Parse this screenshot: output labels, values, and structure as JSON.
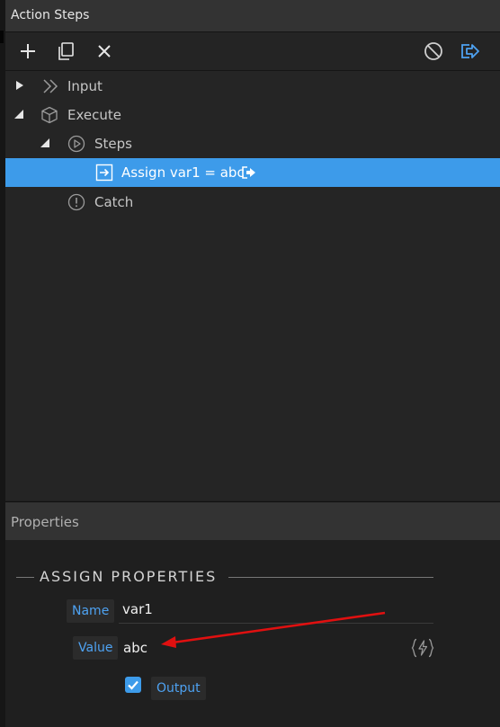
{
  "header": {
    "title": "Action Steps"
  },
  "toolbar": {
    "buttons": [
      {
        "icon": "plus-icon"
      },
      {
        "icon": "copy-icon"
      },
      {
        "icon": "close-icon"
      },
      {
        "icon": "disable-icon"
      },
      {
        "icon": "exit-icon"
      }
    ]
  },
  "tree": {
    "items": [
      {
        "label": "Input",
        "icon": "chevrons-right-icon",
        "expanded": false
      },
      {
        "label": "Execute",
        "icon": "cube-icon",
        "expanded": true
      },
      {
        "label": "Steps",
        "icon": "play-circle-icon",
        "expanded": true
      },
      {
        "label": "Assign var1 = abc",
        "icon": "assign-arrow-icon",
        "selected": true,
        "badge_icon": "exit-step-icon"
      },
      {
        "label": "Catch",
        "icon": "exclamation-circle-icon"
      }
    ]
  },
  "properties": {
    "panel_title": "Properties",
    "section_title": "ASSIGN PROPERTIES",
    "name": {
      "label": "Name",
      "value": "var1"
    },
    "value": {
      "label": "Value",
      "value": "abc",
      "dynamic_icon": "lightning-icon"
    },
    "output": {
      "label": "Output",
      "checked": true
    }
  },
  "annotation": {
    "type": "red-arrow",
    "color": "#e01010"
  },
  "colors": {
    "accent": "#3d9bea",
    "label_text": "#4ea2f2",
    "header_bg": "#333333",
    "panel_bg": "#252525"
  }
}
